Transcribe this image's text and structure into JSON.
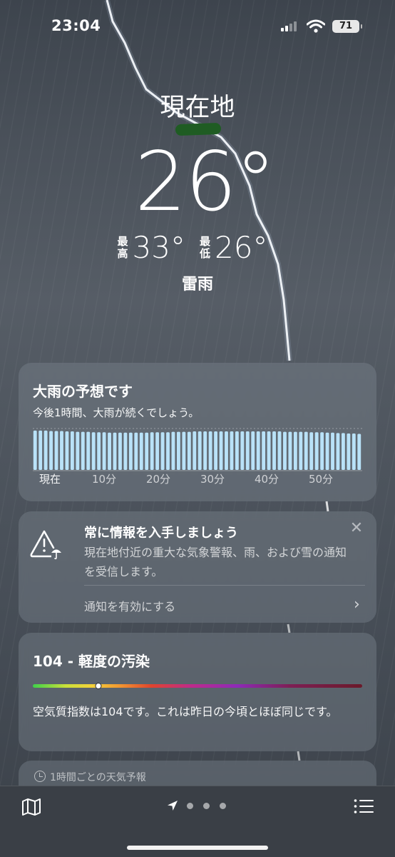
{
  "status_bar": {
    "time": "23:04",
    "battery": "71"
  },
  "header": {
    "location": "現在地",
    "temperature": "26°",
    "high_label_1": "最",
    "high_label_2": "高",
    "high": "33°",
    "low_label_1": "最",
    "low_label_2": "低",
    "low": "26°",
    "condition": "雷雨"
  },
  "rain_card": {
    "title": "大雨の予想です",
    "subtitle": "今後1時間、大雨が続くでしょう。",
    "ticks": [
      "現在",
      "10分",
      "20分",
      "30分",
      "40分",
      "50分"
    ],
    "intensity": [
      0.95,
      0.95,
      0.95,
      0.94,
      0.94,
      0.94,
      0.93,
      0.93,
      0.92,
      0.92,
      0.92,
      0.91,
      0.91,
      0.91,
      0.9,
      0.9,
      0.9,
      0.9,
      0.9,
      0.9,
      0.9,
      0.9,
      0.91,
      0.91,
      0.91,
      0.91,
      0.92,
      0.92,
      0.92,
      0.92,
      0.93,
      0.93,
      0.93,
      0.93,
      0.93,
      0.93,
      0.93,
      0.93,
      0.93,
      0.93,
      0.93,
      0.93,
      0.93,
      0.93,
      0.93,
      0.93,
      0.93,
      0.92,
      0.92,
      0.92,
      0.92,
      0.92,
      0.91,
      0.91,
      0.91,
      0.9,
      0.9,
      0.89,
      0.89,
      0.88,
      0.88,
      0.87
    ]
  },
  "alert_card": {
    "title": "常に情報を入手しましょう",
    "body": "現在地付近の重大な気象警報、雨、および雪の通知を受信します。",
    "close": "✕",
    "action": "通知を有効にする",
    "chevron": "›"
  },
  "aqi_card": {
    "title": "104 - 軽度の汚染",
    "level": 0.2,
    "description": "空気質指数は104です。これは昨日の今頃とほぼ同じです。"
  },
  "hourly_card": {
    "label": "1時間ごとの天気予報"
  },
  "bottom_bar": {
    "icons": [
      "map-icon",
      "location-arrow-icon",
      "list-icon"
    ],
    "page_count": 3
  }
}
